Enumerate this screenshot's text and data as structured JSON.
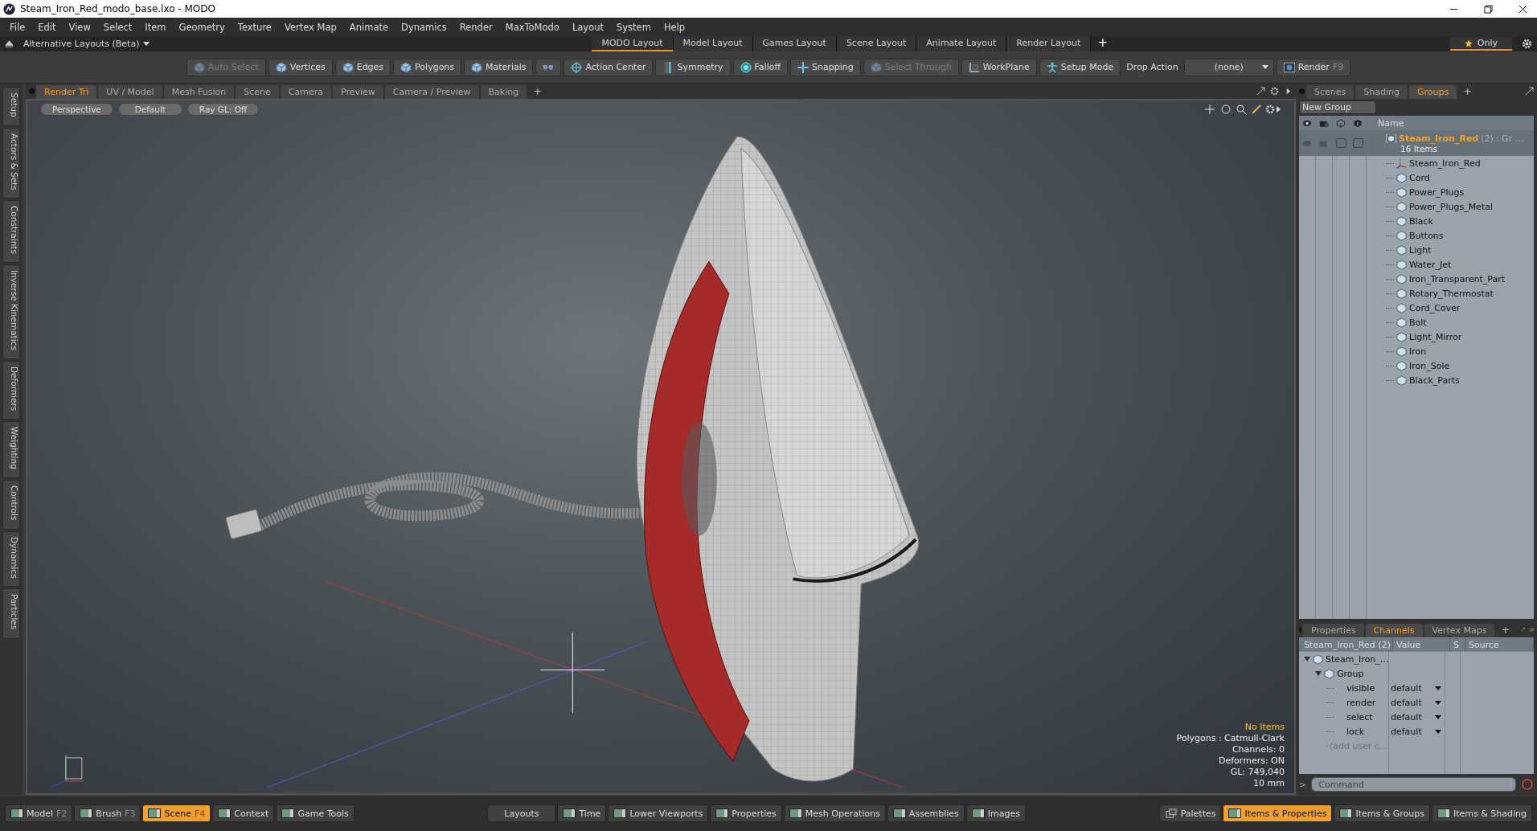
{
  "window": {
    "title": "Steam_Iron_Red_modo_base.lxo - MODO"
  },
  "menu": [
    "File",
    "Edit",
    "View",
    "Select",
    "Item",
    "Geometry",
    "Texture",
    "Vertex Map",
    "Animate",
    "Dynamics",
    "Render",
    "MaxToModo",
    "Layout",
    "System",
    "Help"
  ],
  "layout_bar": {
    "switcher": "Alternative Layouts (Beta)",
    "tabs": [
      {
        "label": "MODO Layout",
        "selected": true
      },
      {
        "label": "Model Layout",
        "selected": false
      },
      {
        "label": "Games Layout",
        "selected": false
      },
      {
        "label": "Scene Layout",
        "selected": false
      },
      {
        "label": "Animate Layout",
        "selected": false
      },
      {
        "label": "Render Layout",
        "selected": false
      }
    ],
    "add": "+",
    "only": "Only"
  },
  "toolbar": {
    "items": [
      {
        "label": "Auto Select",
        "kind": "cube",
        "disabled": true
      },
      {
        "label": "Vertices",
        "kind": "cube",
        "disabled": false
      },
      {
        "label": "Edges",
        "kind": "cube",
        "disabled": false
      },
      {
        "label": "Polygons",
        "kind": "cube",
        "disabled": false
      },
      {
        "label": "Materials",
        "kind": "cube",
        "disabled": false
      },
      {
        "kind": "shield",
        "disabled": false
      },
      {
        "label": "Action Center",
        "kind": "target",
        "disabled": false
      },
      {
        "label": "Symmetry",
        "kind": "line",
        "disabled": false
      },
      {
        "label": "Falloff",
        "kind": "ring",
        "disabled": false
      },
      {
        "label": "Snapping",
        "kind": "cross",
        "disabled": false
      },
      {
        "label": "Select Through",
        "kind": "cube",
        "disabled": true
      },
      {
        "label": "WorkPlane",
        "kind": "plane",
        "disabled": false
      },
      {
        "label": "Setup Mode",
        "kind": "figure",
        "disabled": false
      }
    ],
    "drop_action": {
      "label": "Drop Action",
      "value": "(none)"
    },
    "render": {
      "label": "Render",
      "shortcut": "F9"
    }
  },
  "side_tabs": [
    "Setup",
    "Actors & Sets",
    "Constraints",
    "Inverse Kinematics",
    "Deformers",
    "Weighting",
    "Controls",
    "Dynamics",
    "Particles"
  ],
  "viewport_tabs": [
    {
      "label": "Render Tri",
      "selected": true
    },
    {
      "label": "UV / Model",
      "selected": false
    },
    {
      "label": "Mesh Fusion",
      "selected": false
    },
    {
      "label": "Scene",
      "selected": false
    },
    {
      "label": "Camera",
      "selected": false
    },
    {
      "label": "Preview",
      "selected": false
    },
    {
      "label": "Camera / Preview",
      "selected": false
    },
    {
      "label": "Baking",
      "selected": false
    }
  ],
  "viewport_add": "+",
  "viewport": {
    "buttons": [
      "Perspective",
      "Default",
      "Ray GL: Off"
    ],
    "status": "No Items",
    "info": [
      "Polygons : Catmull-Clark",
      "Channels: 0",
      "Deformers: ON",
      "GL: 749,040",
      "10 mm"
    ]
  },
  "groups_panel": {
    "tabs": [
      {
        "label": "Scenes",
        "selected": false
      },
      {
        "label": "Shading",
        "selected": false
      },
      {
        "label": "Groups",
        "selected": true
      }
    ],
    "add": "+",
    "new_group": "New Group",
    "name_column": "Name",
    "group": {
      "name": "Steam_Iron_Red",
      "count": "(2)",
      "type": ": Gr …",
      "items_count": "16 Items",
      "children": [
        {
          "label": "Steam_Iron_Red",
          "kind": "locator"
        },
        {
          "label": "Cord",
          "kind": "mesh"
        },
        {
          "label": "Power_Plugs",
          "kind": "mesh"
        },
        {
          "label": "Power_Plugs_Metal",
          "kind": "mesh"
        },
        {
          "label": "Black",
          "kind": "mesh"
        },
        {
          "label": "Buttons",
          "kind": "mesh"
        },
        {
          "label": "Light",
          "kind": "mesh"
        },
        {
          "label": "Water_Jet",
          "kind": "mesh"
        },
        {
          "label": "Iron_Transparent_Part",
          "kind": "mesh"
        },
        {
          "label": "Rotary_Thermostat",
          "kind": "mesh"
        },
        {
          "label": "Cord_Cover",
          "kind": "mesh"
        },
        {
          "label": "Bolt",
          "kind": "mesh"
        },
        {
          "label": "Light_Mirror",
          "kind": "mesh"
        },
        {
          "label": "Iron",
          "kind": "mesh"
        },
        {
          "label": "Iron_Sole",
          "kind": "mesh"
        },
        {
          "label": "Black_Parts",
          "kind": "mesh"
        }
      ]
    }
  },
  "channels_panel": {
    "tabs": [
      {
        "label": "Properties",
        "selected": false
      },
      {
        "label": "Channels",
        "selected": true
      },
      {
        "label": "Vertex Maps",
        "selected": false
      }
    ],
    "add": "+",
    "columns": [
      "Steam_Iron_Red (2)",
      "Value",
      "S",
      "Source"
    ],
    "tree": [
      {
        "label": "Steam_Iron_…",
        "kind": "item",
        "expanded": true,
        "children": [
          {
            "label": "Group",
            "kind": "item",
            "expanded": true,
            "children": [
              {
                "label": "visible",
                "kind": "channel",
                "value": "default"
              },
              {
                "label": "render",
                "kind": "channel",
                "value": "default"
              },
              {
                "label": "select",
                "kind": "channel",
                "value": "default"
              },
              {
                "label": "lock",
                "kind": "channel",
                "value": "default"
              },
              {
                "label": "(add user c…",
                "kind": "placeholder"
              }
            ]
          }
        ]
      }
    ]
  },
  "command": {
    "prompt": ">",
    "placeholder": "Command"
  },
  "bottom_bar": {
    "left": [
      {
        "label": "Model",
        "shortcut": "F2",
        "selected": false
      },
      {
        "label": "Brush",
        "shortcut": "F3",
        "selected": false
      },
      {
        "label": "Scene",
        "shortcut": "F4",
        "selected": true
      },
      {
        "label": "Context",
        "selected": false
      },
      {
        "label": "Game Tools",
        "selected": false
      }
    ],
    "center": [
      {
        "label": "Layouts",
        "kind": "plain"
      },
      {
        "label": "Time",
        "kind": "panel"
      },
      {
        "label": "Lower Viewports",
        "kind": "panel"
      },
      {
        "label": "Properties",
        "kind": "panel"
      },
      {
        "label": "Mesh Operations",
        "kind": "panel"
      },
      {
        "label": "Assemblies",
        "kind": "panel"
      },
      {
        "label": "Images",
        "kind": "panel"
      }
    ],
    "right": [
      {
        "label": "Palettes",
        "kind": "palette",
        "selected": false
      },
      {
        "label": "Items & Properties",
        "kind": "panel",
        "selected": true
      },
      {
        "label": "Items & Groups",
        "kind": "panel",
        "selected": false
      },
      {
        "label": "Items & Shading",
        "kind": "panel",
        "selected": false
      }
    ]
  }
}
